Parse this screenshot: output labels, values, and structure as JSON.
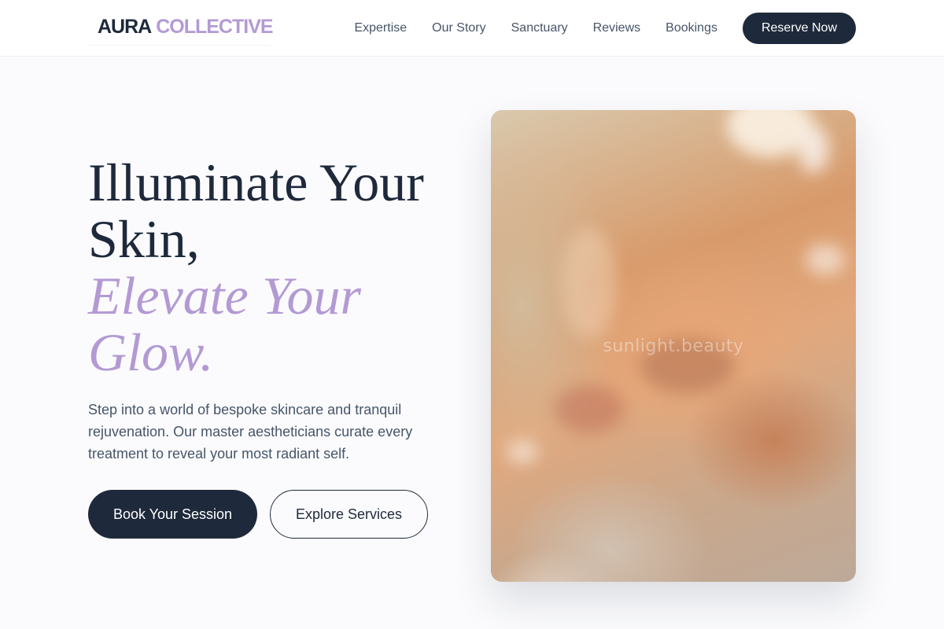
{
  "brand": {
    "name_primary": "AURA",
    "name_accent": "COLLECTIVE"
  },
  "nav": {
    "links": [
      "Expertise",
      "Our Story",
      "Sanctuary",
      "Reviews",
      "Bookings"
    ],
    "cta_label": "Reserve Now"
  },
  "hero": {
    "title_line1": "Illuminate Your Skin,",
    "title_line2": "Elevate Your Glow.",
    "description": "Step into a world of bespoke skincare and tranquil rejuvenation. Our master aestheticians curate every treatment to reveal your most radiant self.",
    "primary_cta": "Book Your Session",
    "secondary_cta": "Explore Services",
    "image_watermark": "sunlight.beauty"
  },
  "colors": {
    "navy": "#1e293b",
    "lavender": "#b39ad4",
    "text_muted": "#475569",
    "background": "#fbfbfd"
  }
}
